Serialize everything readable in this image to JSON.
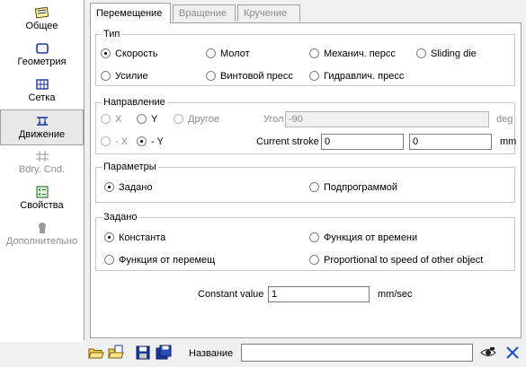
{
  "sidebar": {
    "items": [
      {
        "label": "Общее",
        "icon": "general-icon",
        "state": "normal"
      },
      {
        "label": "Геометрия",
        "icon": "geometry-icon",
        "state": "normal"
      },
      {
        "label": "Сетка",
        "icon": "mesh-icon",
        "state": "normal"
      },
      {
        "label": "Движение",
        "icon": "movement-icon",
        "state": "active"
      },
      {
        "label": "Bdry. Cnd.",
        "icon": "boundary-conditions-icon",
        "state": "disabled"
      },
      {
        "label": "Свойства",
        "icon": "properties-icon",
        "state": "normal"
      },
      {
        "label": "Дополнительно",
        "icon": "advanced-icon",
        "state": "disabled"
      }
    ]
  },
  "tabs": [
    {
      "label": "Перемещение",
      "state": "active"
    },
    {
      "label": "Вращение",
      "state": "disabled"
    },
    {
      "label": "Кручение",
      "state": "disabled"
    }
  ],
  "type_group": {
    "title": "Тип",
    "options": [
      "Скорость",
      "Молот",
      "Механич. персс",
      "Sliding die",
      "Усилие",
      "Винтовой пресс",
      "Гидравлич. пресс"
    ],
    "selected": "Скорость"
  },
  "direction_group": {
    "title": "Направление",
    "options": [
      "X",
      "Y",
      "Другое",
      "- X",
      "- Y"
    ],
    "selected": "- Y",
    "angle_label": "Угол",
    "angle_value": "-90",
    "angle_unit": "deg",
    "stroke_label": "Current stroke",
    "stroke_value_1": "0",
    "stroke_value_2": "0",
    "stroke_unit": "mm"
  },
  "params_group": {
    "title": "Параметры",
    "options": [
      "Задано",
      "Подпрограммой"
    ],
    "selected": "Задано"
  },
  "given_group": {
    "title": "Задано",
    "options": [
      "Константа",
      "Функция от времени",
      "Функция от перемещ",
      "Proportional to speed of other object"
    ],
    "selected": "Константа"
  },
  "constant": {
    "label": "Constant value",
    "value": "1",
    "unit": "mm/sec"
  },
  "toolbar": {
    "name_label": "Название",
    "name_value": ""
  },
  "colors": {
    "icon_blue": "#1a3a9c",
    "icon_green": "#2f7d2f",
    "close_blue": "#1b4fd8"
  }
}
